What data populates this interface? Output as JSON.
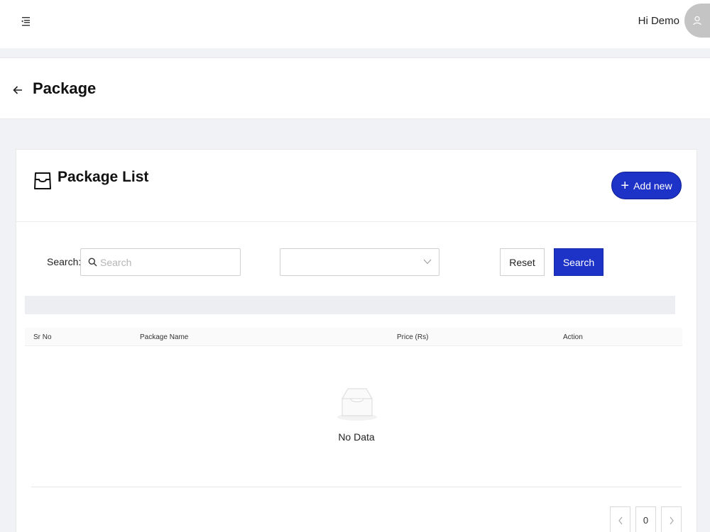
{
  "header": {
    "greeting": "Hi Demo"
  },
  "page": {
    "title": "Package"
  },
  "card": {
    "title": "Package List",
    "add_label": "Add new"
  },
  "filters": {
    "search_label": "Search:",
    "search_placeholder": "Search",
    "select_value": "",
    "reset_label": "Reset",
    "search_button_label": "Search"
  },
  "table": {
    "columns": [
      "Sr No",
      "Package Name",
      "Price (Rs)",
      "Action"
    ],
    "empty_text": "No Data"
  },
  "pagination": {
    "current_page": "0"
  },
  "colors": {
    "primary": "#1d33c7",
    "background": "#f0f2f5"
  }
}
